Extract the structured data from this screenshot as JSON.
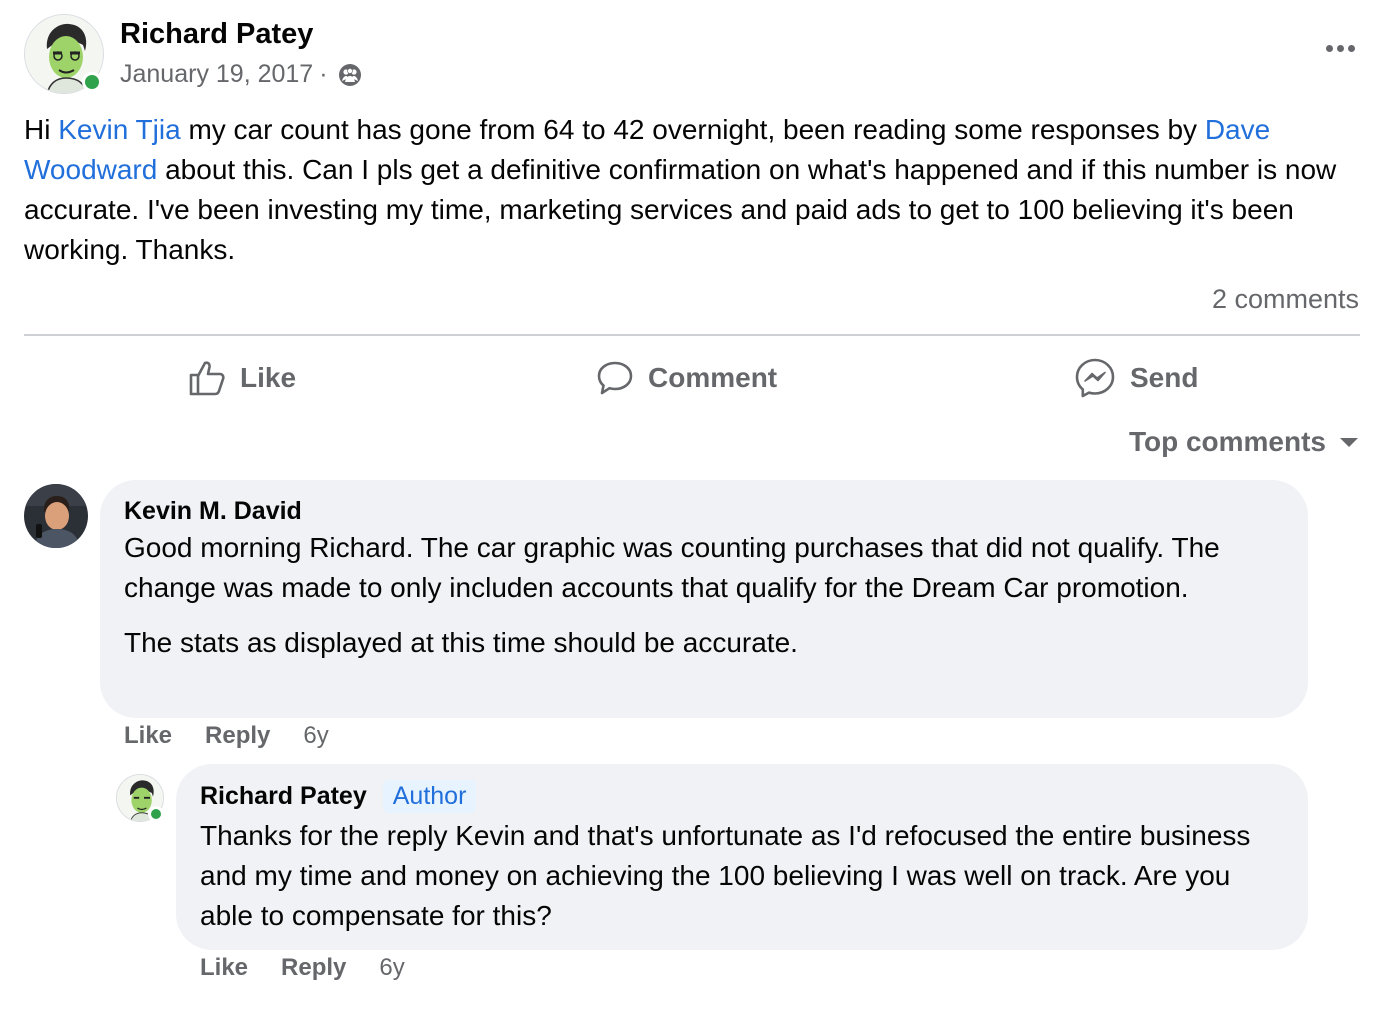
{
  "post": {
    "author": "Richard Patey",
    "date": "January 19, 2017",
    "separator": "·",
    "audience_icon": "friends-icon",
    "body": {
      "p1": "Hi ",
      "mention1": "Kevin Tjia",
      "p2": " my car count has gone from 64 to 42 overnight, been reading some responses by ",
      "mention2": "Dave Woodward",
      "p3": " about this. Can I pls get a definitive confirmation on what's happened and if this number is now accurate. I've been investing my time, marketing services and paid ads to get to 100 believing it's been working. Thanks."
    },
    "comment_count": "2 comments"
  },
  "actions": {
    "like": "Like",
    "comment": "Comment",
    "send": "Send"
  },
  "sort_label": "Top comments",
  "comments": [
    {
      "author": "Kevin M. David",
      "paragraph1": "Good morning Richard. The car graphic was counting purchases that did not qualify. The change was made to only includen accounts that qualify for the Dream Car promotion.",
      "paragraph2": "The stats as displayed at this time should be accurate.",
      "like": "Like",
      "reply": "Reply",
      "time": "6y"
    },
    {
      "author": "Richard Patey",
      "badge": "Author",
      "text": "Thanks for the reply Kevin and that's unfortunate as I'd refocused the entire business and my time and money on achieving the 100 believing I was well on track. Are you able to compensate for this?",
      "like": "Like",
      "reply": "Reply",
      "time": "6y"
    }
  ],
  "colors": {
    "link": "#216fdb",
    "secondary_text": "#65676b",
    "bubble": "#f0f2f5",
    "online": "#31a24c"
  }
}
